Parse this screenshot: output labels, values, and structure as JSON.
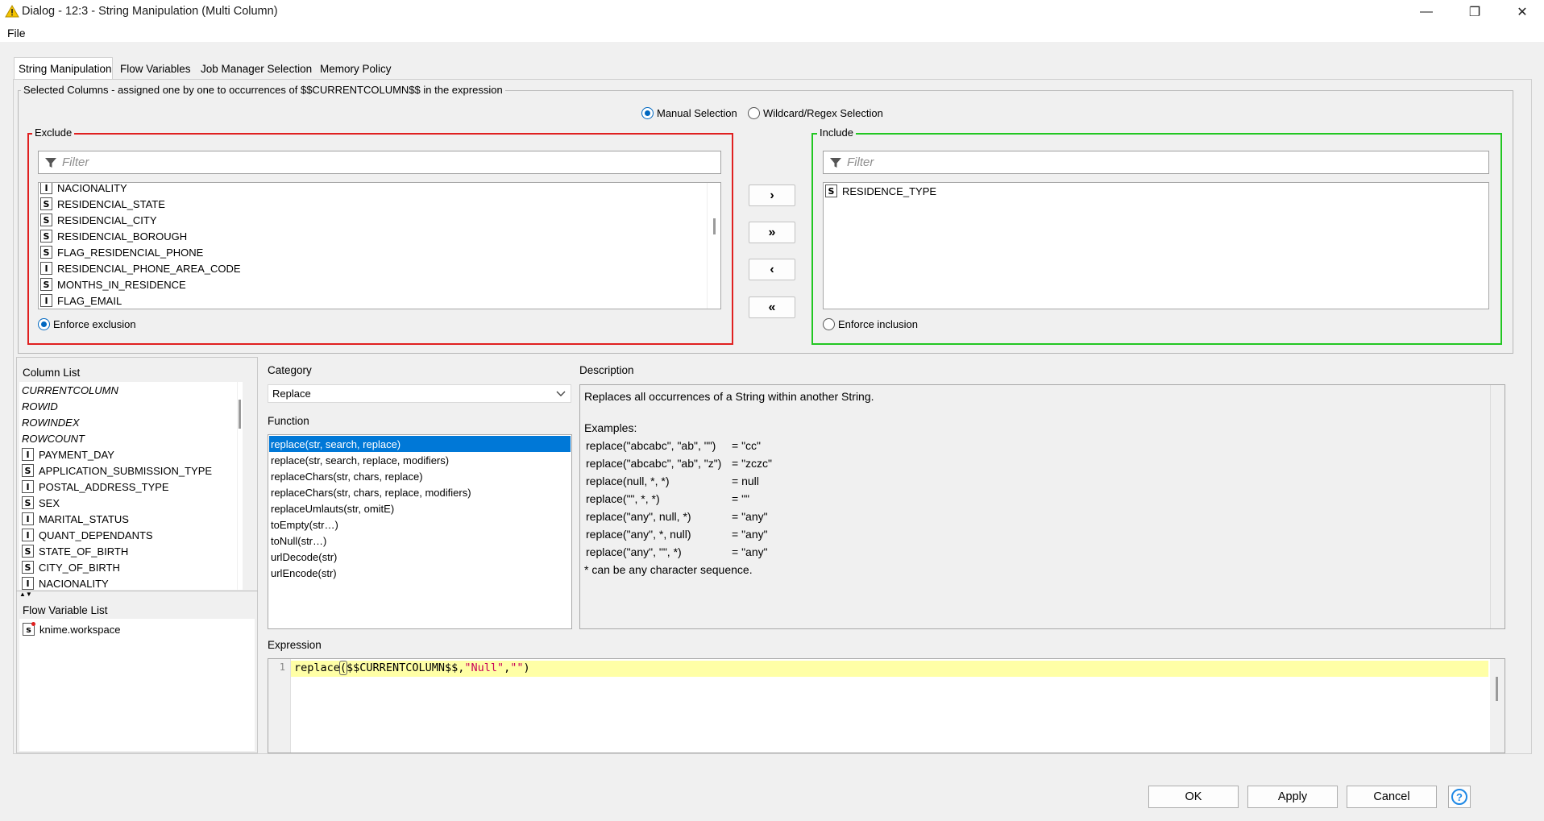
{
  "window": {
    "title": "Dialog - 12:3 - String Manipulation (Multi Column)",
    "minimize_glyph": "—",
    "maximize_glyph": "❐",
    "close_glyph": "✕"
  },
  "menu": {
    "file": "File"
  },
  "tabs": [
    {
      "label": "String Manipulation",
      "active": true
    },
    {
      "label": "Flow Variables",
      "active": false
    },
    {
      "label": "Job Manager Selection",
      "active": false
    },
    {
      "label": "Memory Policy",
      "active": false
    }
  ],
  "selected_columns": {
    "legend": "Selected Columns - assigned one by one to occurrences of $$CURRENTCOLUMN$$ in the expression",
    "manual_selection": "Manual Selection",
    "wildcard_selection": "Wildcard/Regex Selection",
    "selection_mode": "manual"
  },
  "exclude": {
    "legend": "Exclude",
    "filter_placeholder": "Filter",
    "border_color": "#e02020",
    "items": [
      {
        "type": "I",
        "name": "NACIONALITY"
      },
      {
        "type": "S",
        "name": "RESIDENCIAL_STATE"
      },
      {
        "type": "S",
        "name": "RESIDENCIAL_CITY"
      },
      {
        "type": "S",
        "name": "RESIDENCIAL_BOROUGH"
      },
      {
        "type": "S",
        "name": "FLAG_RESIDENCIAL_PHONE"
      },
      {
        "type": "I",
        "name": "RESIDENCIAL_PHONE_AREA_CODE"
      },
      {
        "type": "S",
        "name": "MONTHS_IN_RESIDENCE"
      },
      {
        "type": "I",
        "name": "FLAG_EMAIL"
      }
    ],
    "enforce_label": "Enforce exclusion",
    "enforce_selected": true
  },
  "include": {
    "legend": "Include",
    "filter_placeholder": "Filter",
    "border_color": "#22c722",
    "items": [
      {
        "type": "S",
        "name": "RESIDENCE_TYPE"
      }
    ],
    "enforce_label": "Enforce inclusion",
    "enforce_selected": false
  },
  "move_buttons": {
    "add": "›",
    "add_all": "»",
    "remove": "‹",
    "remove_all": "«"
  },
  "column_list": {
    "label": "Column List",
    "special": [
      "CURRENTCOLUMN",
      "ROWID",
      "ROWINDEX",
      "ROWCOUNT"
    ],
    "columns": [
      {
        "type": "I",
        "name": "PAYMENT_DAY"
      },
      {
        "type": "S",
        "name": "APPLICATION_SUBMISSION_TYPE"
      },
      {
        "type": "I",
        "name": "POSTAL_ADDRESS_TYPE"
      },
      {
        "type": "S",
        "name": "SEX"
      },
      {
        "type": "I",
        "name": "MARITAL_STATUS"
      },
      {
        "type": "I",
        "name": "QUANT_DEPENDANTS"
      },
      {
        "type": "S",
        "name": "STATE_OF_BIRTH"
      },
      {
        "type": "S",
        "name": "CITY_OF_BIRTH"
      },
      {
        "type": "I",
        "name": "NACIONALITY"
      }
    ]
  },
  "flow_variable_list": {
    "label": "Flow Variable List",
    "items": [
      {
        "type": "s",
        "name": "knime.workspace"
      }
    ]
  },
  "category": {
    "label": "Category",
    "selected": "Replace"
  },
  "function": {
    "label": "Function",
    "selected_index": 0,
    "items": [
      "replace(str, search, replace)",
      "replace(str, search, replace, modifiers)",
      "replaceChars(str, chars, replace)",
      "replaceChars(str, chars, replace, modifiers)",
      "replaceUmlauts(str, omitE)",
      "toEmpty(str…)",
      "toNull(str…)",
      "urlDecode(str)",
      "urlEncode(str)"
    ]
  },
  "description": {
    "label": "Description",
    "intro": "Replaces all occurrences of a String within another String.",
    "examples_label": "Examples:",
    "examples": [
      {
        "code": "replace(\"abcabc\", \"ab\", \"\")",
        "result": "= \"cc\""
      },
      {
        "code": "replace(\"abcabc\", \"ab\", \"z\")",
        "result": "= \"zczc\""
      },
      {
        "code": "replace(null, *, *)",
        "result": "= null"
      },
      {
        "code": "replace(\"\", *, *)",
        "result": "= \"\""
      },
      {
        "code": "replace(\"any\", null, *)",
        "result": "= \"any\""
      },
      {
        "code": "replace(\"any\", *, null)",
        "result": "= \"any\""
      },
      {
        "code": "replace(\"any\", \"\", *)",
        "result": "= \"any\""
      }
    ],
    "footnote": "* can be any character sequence."
  },
  "expression": {
    "label": "Expression",
    "line_number": "1",
    "fn": "replace",
    "paren_open": "(",
    "arg_column": "$$CURRENTCOLUMN$$",
    "comma1": ",",
    "arg_search": "\"Null\"",
    "comma2": ",",
    "arg_replace": "\"\"",
    "paren_close": ")"
  },
  "buttons": {
    "ok": "OK",
    "apply": "Apply",
    "cancel": "Cancel",
    "help": "?"
  }
}
